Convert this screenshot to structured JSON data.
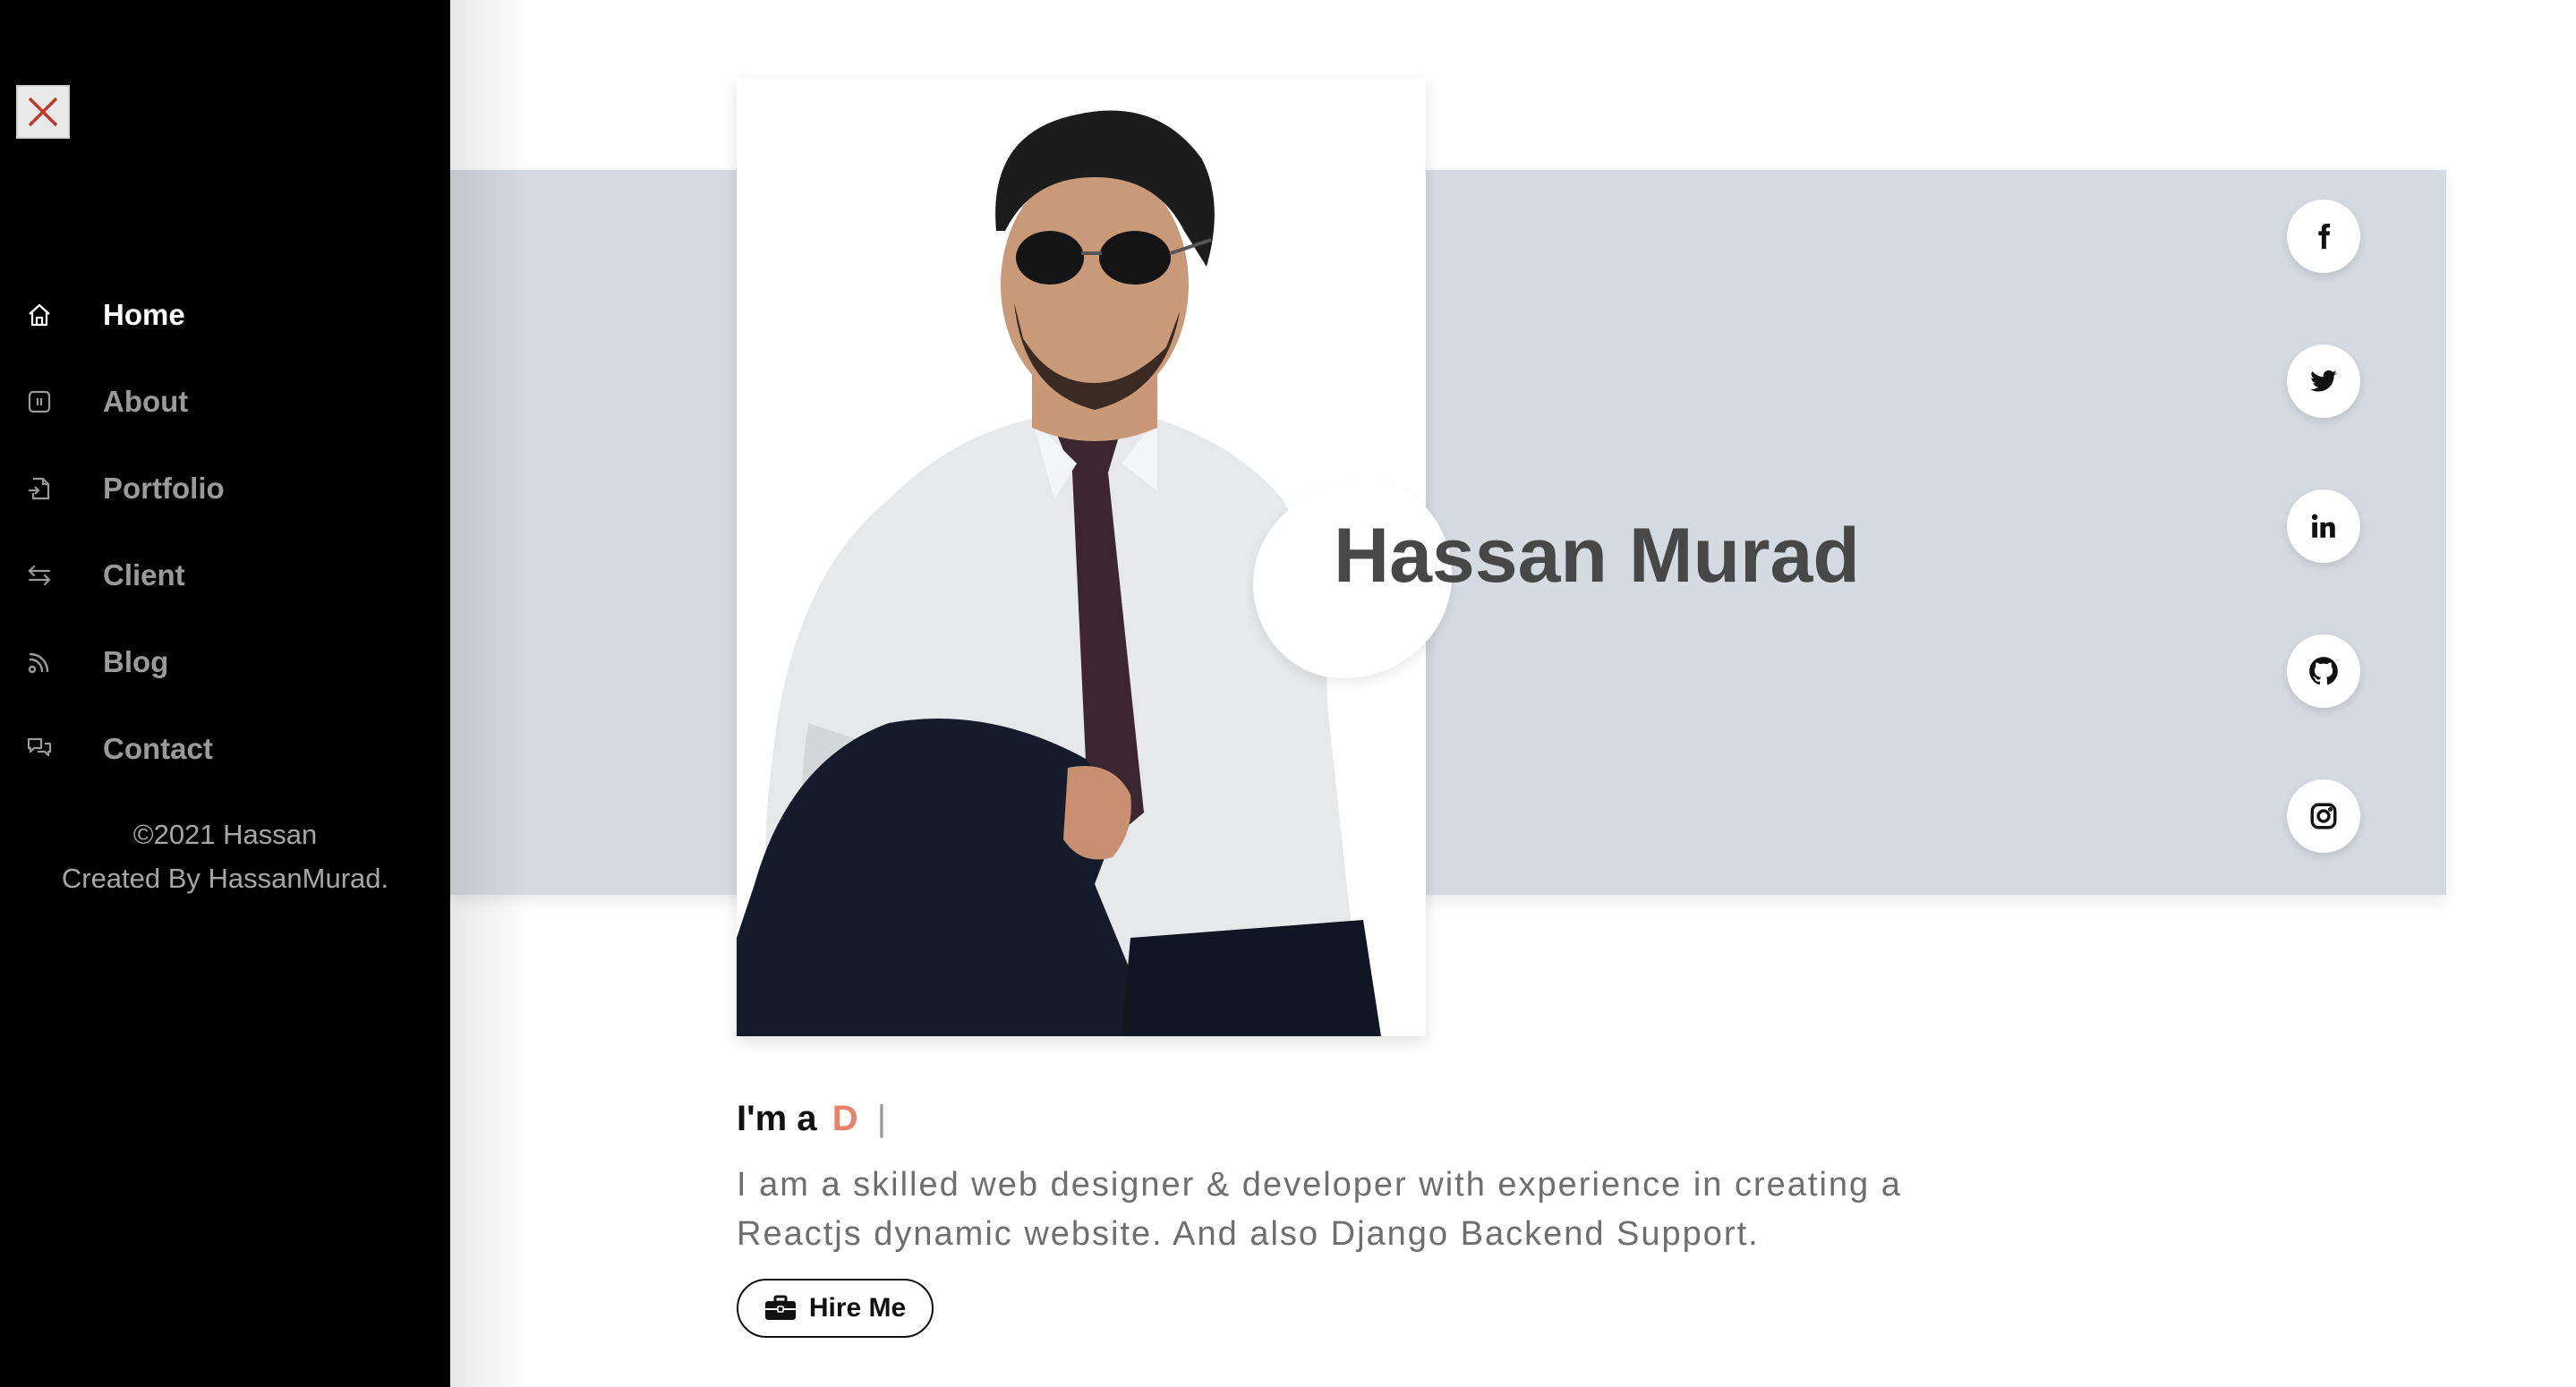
{
  "sidebar": {
    "close_icon": "close-icon",
    "items": [
      {
        "label": "Home",
        "icon": "home-icon",
        "active": true
      },
      {
        "label": "About",
        "icon": "info-icon",
        "active": false
      },
      {
        "label": "Portfolio",
        "icon": "file-icon",
        "active": false
      },
      {
        "label": "Client",
        "icon": "swap-icon",
        "active": false
      },
      {
        "label": "Blog",
        "icon": "blog-icon",
        "active": false
      },
      {
        "label": "Contact",
        "icon": "chat-icon",
        "active": false
      }
    ],
    "footer_line1": "©2021 Hassan",
    "footer_line2": "Created By HassanMurad."
  },
  "hero": {
    "name": "Hassan Murad",
    "photo": "portrait-photo",
    "socials": [
      "facebook-icon",
      "twitter-icon",
      "linkedin-icon",
      "github-icon",
      "instagram-icon"
    ]
  },
  "intro": {
    "prefix": "I'm a",
    "typed": "D",
    "cursor": "|",
    "description": "I am a skilled web designer & developer with experience in creating a Reactjs dynamic website. And also Django Backend Support.",
    "hire_label": "Hire Me",
    "hire_icon": "briefcase-icon"
  },
  "colors": {
    "sidebar_bg": "#000000",
    "banner_bg": "#d6dbe1",
    "accent": "#e8826a",
    "close_x": "#c0392b"
  }
}
